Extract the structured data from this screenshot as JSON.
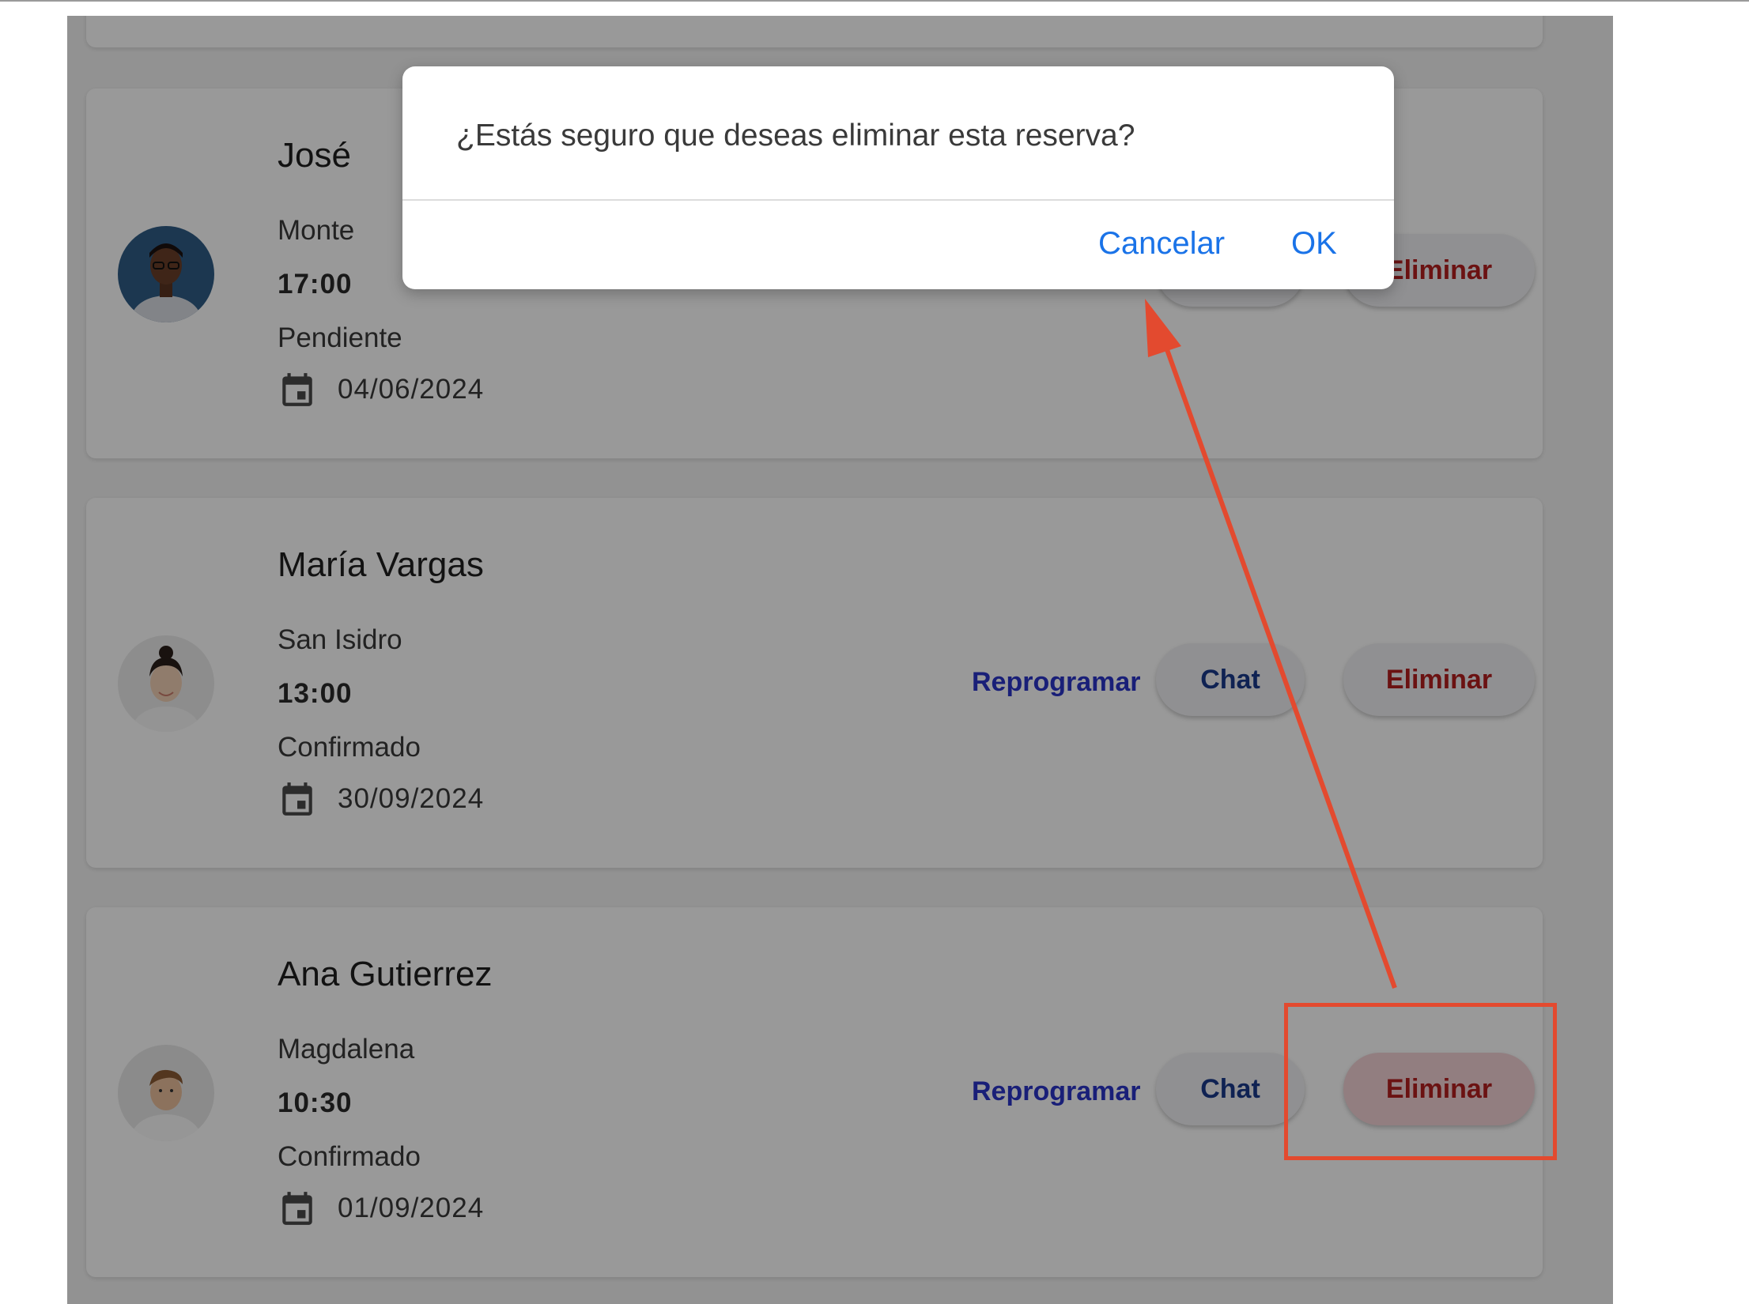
{
  "reservations": [
    {
      "name": "José",
      "location": "Monte",
      "time": "17:00",
      "status": "Pendiente",
      "date": "04/06/2024"
    },
    {
      "name": "María Vargas",
      "location": "San Isidro",
      "time": "13:00",
      "status": "Confirmado",
      "date": "30/09/2024"
    },
    {
      "name": "Ana Gutierrez",
      "location": "Magdalena",
      "time": "10:30",
      "status": "Confirmado",
      "date": "01/09/2024"
    }
  ],
  "actions": {
    "reschedule": "Reprogramar",
    "chat": "Chat",
    "delete": "Eliminar"
  },
  "dialog": {
    "message": "¿Estás seguro que deseas eliminar esta reserva?",
    "cancel": "Cancelar",
    "ok": "OK"
  },
  "colors": {
    "annotation": "#e34a2f",
    "link": "#1a73e8",
    "delete": "#b31e1e"
  }
}
